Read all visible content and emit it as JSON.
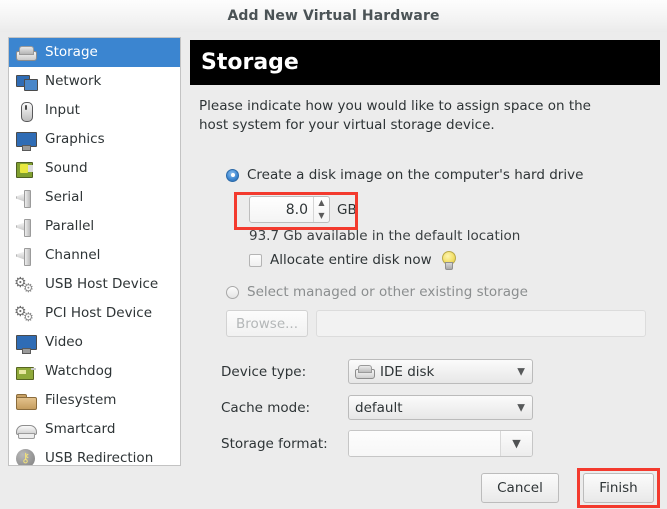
{
  "window": {
    "title": "Add New Virtual Hardware"
  },
  "sidebar": {
    "items": [
      {
        "label": "Storage",
        "icon": "disk-icon",
        "selected": true
      },
      {
        "label": "Network",
        "icon": "network-icon",
        "selected": false
      },
      {
        "label": "Input",
        "icon": "mouse-icon",
        "selected": false
      },
      {
        "label": "Graphics",
        "icon": "monitor-icon",
        "selected": false
      },
      {
        "label": "Sound",
        "icon": "sound-icon",
        "selected": false
      },
      {
        "label": "Serial",
        "icon": "port-icon",
        "selected": false
      },
      {
        "label": "Parallel",
        "icon": "port-icon",
        "selected": false
      },
      {
        "label": "Channel",
        "icon": "port-icon",
        "selected": false
      },
      {
        "label": "USB Host Device",
        "icon": "gears-icon",
        "selected": false
      },
      {
        "label": "PCI Host Device",
        "icon": "gears-icon",
        "selected": false
      },
      {
        "label": "Video",
        "icon": "monitor-icon",
        "selected": false
      },
      {
        "label": "Watchdog",
        "icon": "card-icon",
        "selected": false
      },
      {
        "label": "Filesystem",
        "icon": "folder-icon",
        "selected": false
      },
      {
        "label": "Smartcard",
        "icon": "smartcard-icon",
        "selected": false
      },
      {
        "label": "USB Redirection",
        "icon": "usb-icon",
        "selected": false
      }
    ]
  },
  "main": {
    "banner_title": "Storage",
    "description": "Please indicate how you would like to assign space on the host system for your virtual storage device.",
    "create_option": {
      "label": "Create a disk image on the computer's hard drive",
      "selected": true,
      "size_value": "8.0",
      "size_unit": "GB",
      "available_text": "93.7 Gb available in the default location",
      "allocate_label": "Allocate entire disk now",
      "allocate_checked": false,
      "tip_icon": "lightbulb-icon"
    },
    "existing_option": {
      "label": "Select managed or other existing storage",
      "selected": false,
      "browse_label": "Browse...",
      "path_value": ""
    },
    "fields": [
      {
        "label": "Device type:",
        "value": "IDE disk",
        "icon": "disk-icon"
      },
      {
        "label": "Cache mode:",
        "value": "default",
        "icon": ""
      },
      {
        "label": "Storage format:",
        "value": "",
        "icon": ""
      }
    ]
  },
  "footer": {
    "cancel_label": "Cancel",
    "finish_label": "Finish"
  },
  "annotations": {
    "highlight_color": "#f33a2e",
    "boxes": [
      "disk-size-spinner",
      "finish-button"
    ]
  }
}
